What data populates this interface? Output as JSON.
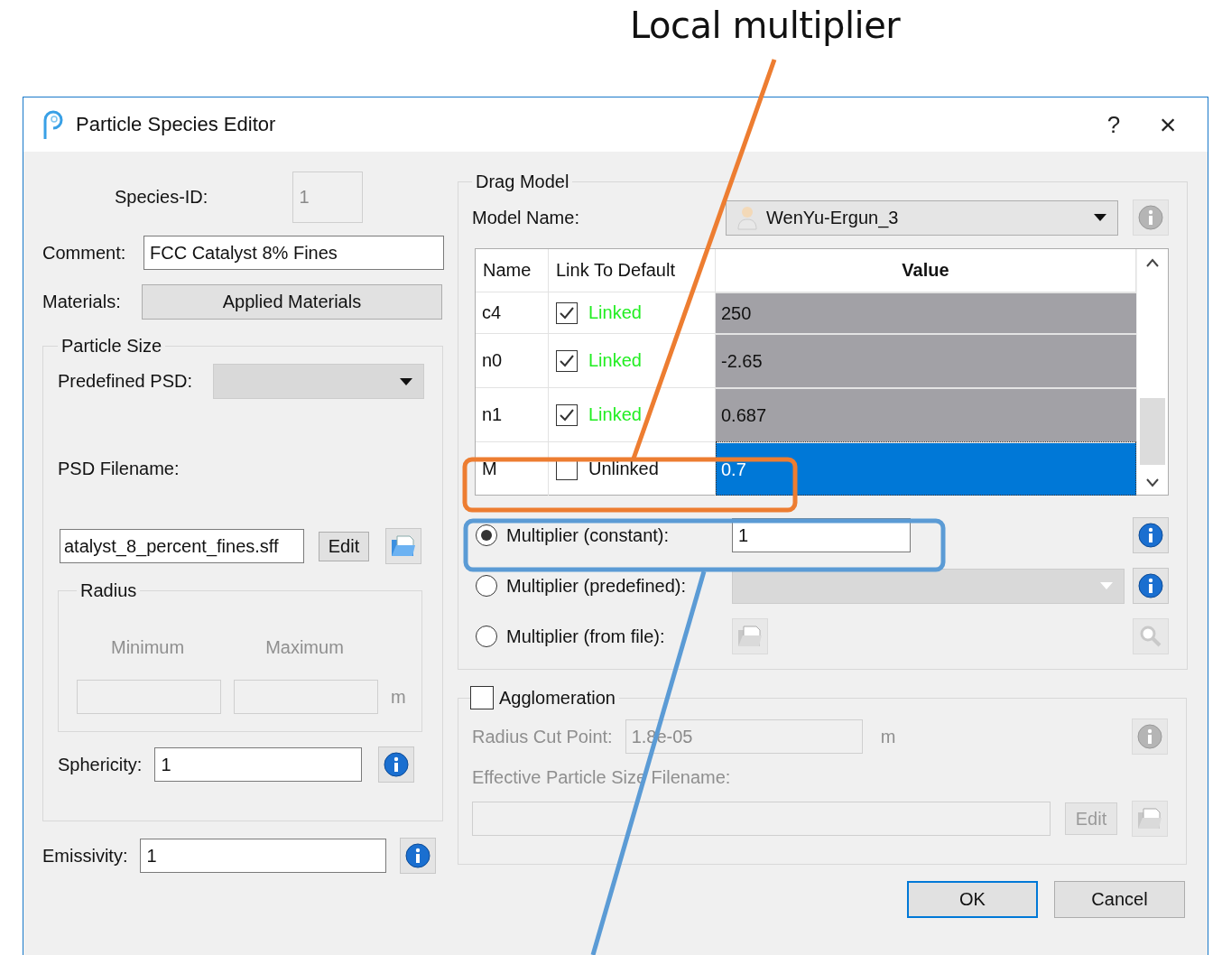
{
  "annotation": {
    "label": "Local multiplier"
  },
  "window": {
    "title": "Particle Species Editor",
    "help": "?",
    "close": "×"
  },
  "species_id": {
    "label": "Species-ID:",
    "value": "1"
  },
  "comment": {
    "label": "Comment:",
    "value": "FCC Catalyst 8% Fines"
  },
  "materials": {
    "label": "Materials:",
    "button": "Applied Materials"
  },
  "particle_size": {
    "title": "Particle Size",
    "predefined_label": "Predefined PSD:",
    "filename_label": "PSD Filename:",
    "filename": "atalyst_8_percent_fines.sff",
    "edit": "Edit",
    "radius": {
      "title": "Radius",
      "minimum": "Minimum",
      "maximum": "Maximum",
      "unit": "m"
    },
    "sphericity": {
      "label": "Sphericity:",
      "value": "1"
    }
  },
  "emissivity": {
    "label": "Emissivity:",
    "value": "1"
  },
  "drag_model": {
    "title": "Drag Model",
    "model_label": "Model Name:",
    "model": "WenYu-Ergun_3",
    "columns": [
      "Name",
      "Link To Default",
      "Value"
    ],
    "rows": [
      {
        "name": "c4",
        "linked": true,
        "link_label": "Linked",
        "value": "250",
        "selected": false
      },
      {
        "name": "n0",
        "linked": true,
        "link_label": "Linked",
        "value": "-2.65",
        "selected": false
      },
      {
        "name": "n1",
        "linked": true,
        "link_label": "Linked",
        "value": "0.687",
        "selected": false
      },
      {
        "name": "M",
        "linked": false,
        "link_label": "Unlinked",
        "value": "0.7",
        "selected": true
      }
    ],
    "multipliers": [
      {
        "kind": "constant",
        "label": "Multiplier (constant):",
        "selected": true,
        "value": "1"
      },
      {
        "kind": "predefined",
        "label": "Multiplier (predefined):",
        "selected": false
      },
      {
        "kind": "file",
        "label": "Multiplier (from file):",
        "selected": false
      }
    ]
  },
  "agglomeration": {
    "label": "Agglomeration",
    "checked": false,
    "cut_label": "Radius Cut Point:",
    "cut_value": "1.8e-05",
    "unit": "m",
    "filename_label": "Effective Particle Size Filename:",
    "edit": "Edit"
  },
  "buttons": [
    "OK",
    "Cancel"
  ]
}
